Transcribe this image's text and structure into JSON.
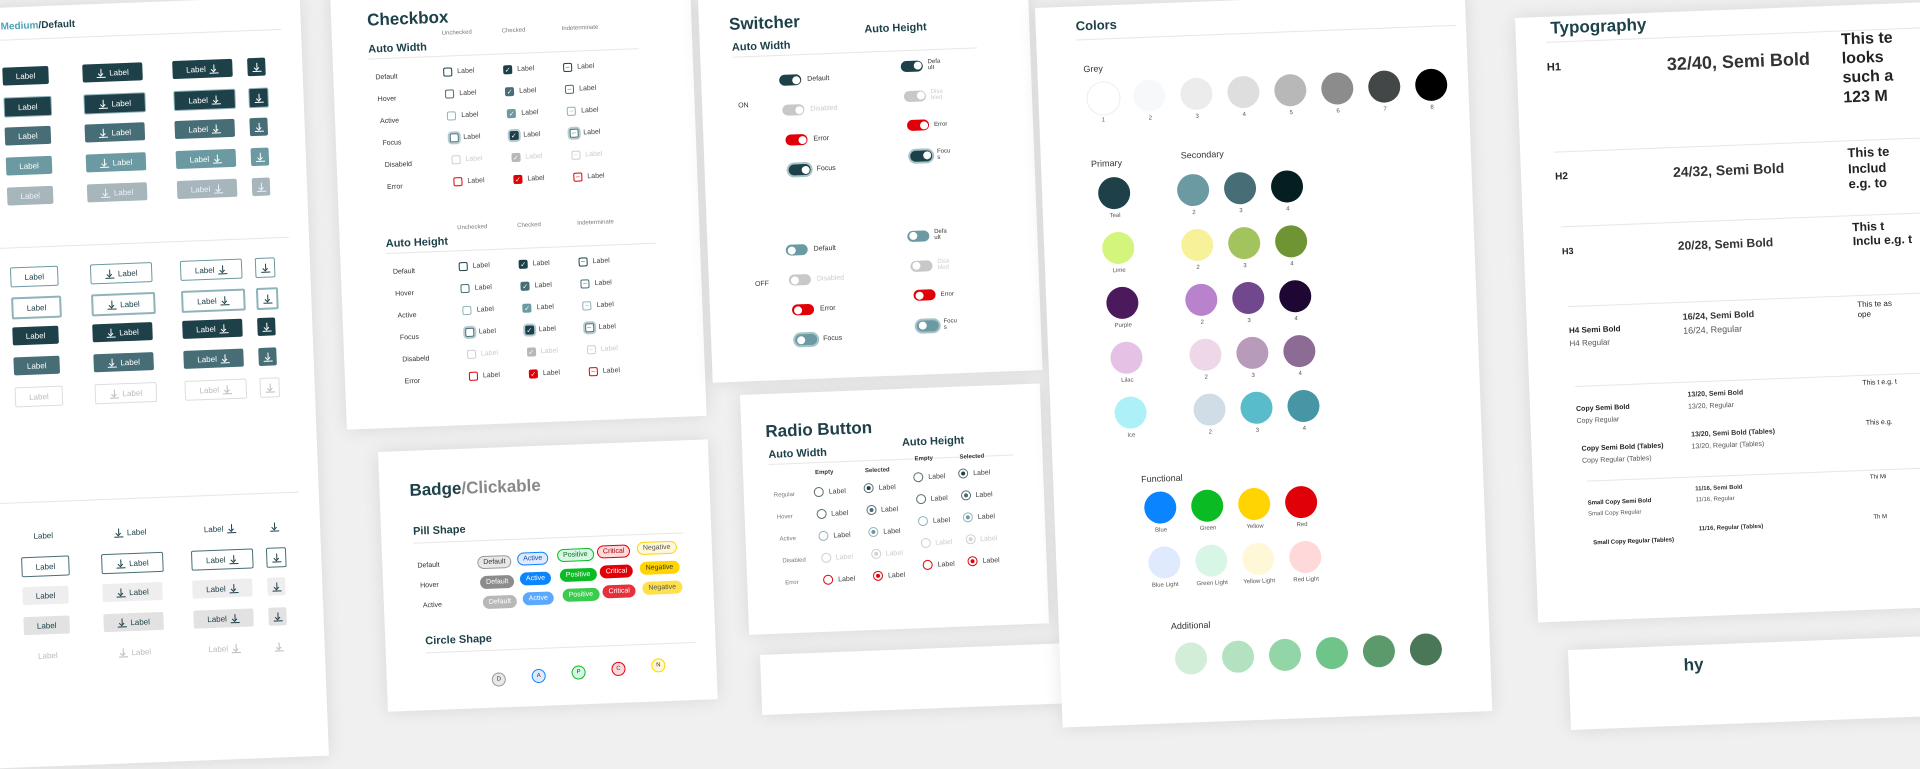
{
  "buttons_card": {
    "title_prefix": "Medium",
    "title_sep": "/",
    "title_suffix": "Default",
    "label": "Label"
  },
  "checkbox_card": {
    "title": "Checkbox",
    "sections": [
      {
        "title": "Auto Width",
        "columns": [
          "Unchecked",
          "Checked",
          "Indeterminate"
        ]
      },
      {
        "title": "Auto Height",
        "columns": [
          "Unchecked",
          "Checked",
          "Indeterminate"
        ]
      }
    ],
    "states": [
      "Default",
      "Hover",
      "Active",
      "Focus",
      "Disabeld",
      "Error"
    ],
    "label": "Label"
  },
  "badge_card": {
    "title": "Badge",
    "title_sep": "/",
    "title_suffix": "Clickable",
    "pill_section": "Pill Shape",
    "circle_section": "Circle Shape",
    "states": [
      "Default",
      "Hover",
      "Active"
    ],
    "kinds": [
      "Default",
      "Active",
      "Positive",
      "Critical",
      "Negative"
    ],
    "circle_letters": [
      "D",
      "A",
      "P",
      "C",
      "N"
    ]
  },
  "switcher_card": {
    "title": "Switcher",
    "col_auto_width": "Auto Width",
    "col_auto_height": "Auto Height",
    "on_label": "ON",
    "off_label": "OFF",
    "states": [
      "Default",
      "Disabled",
      "Error",
      "Focus"
    ],
    "states_wrapped": [
      "Defa ult",
      "Disa bled",
      "Error",
      "Focu s"
    ]
  },
  "radio_card": {
    "title": "Radio Button",
    "col_auto_width": "Auto Width",
    "col_auto_height": "Auto Height",
    "columns": [
      "Empty",
      "Selected"
    ],
    "states": [
      "Regular",
      "Hover",
      "Active",
      "Disabled",
      "Error"
    ],
    "label": "Label"
  },
  "colors_card": {
    "title": "Colors",
    "grey": {
      "title": "Grey",
      "swatches": [
        {
          "label": "1",
          "color": "#ffffff"
        },
        {
          "label": "2",
          "color": "#f7f8f9"
        },
        {
          "label": "3",
          "color": "#ececec"
        },
        {
          "label": "4",
          "color": "#dedede"
        },
        {
          "label": "5",
          "color": "#b8b8b8"
        },
        {
          "label": "6",
          "color": "#8c8c8c"
        },
        {
          "label": "7",
          "color": "#434748"
        },
        {
          "label": "8",
          "color": "#000000"
        }
      ]
    },
    "primary": {
      "title": "Primary",
      "swatches": [
        {
          "label": "Teal",
          "color": "#1d4049"
        },
        {
          "label": "Lime",
          "color": "#d4f57b"
        },
        {
          "label": "Purple",
          "color": "#4b1a5c"
        },
        {
          "label": "Lilac",
          "color": "#e6c1e6"
        },
        {
          "label": "Ice",
          "color": "#aef0f8"
        }
      ]
    },
    "secondary": {
      "title": "Secondary",
      "rows": [
        [
          {
            "label": "2",
            "color": "#6b9aa2"
          },
          {
            "label": "3",
            "color": "#476e76"
          },
          {
            "label": "4",
            "color": "#041e22"
          }
        ],
        [
          {
            "label": "2",
            "color": "#f7f29a"
          },
          {
            "label": "3",
            "color": "#a3c45c"
          },
          {
            "label": "4",
            "color": "#6f9433"
          }
        ],
        [
          {
            "label": "2",
            "color": "#b883cc"
          },
          {
            "label": "3",
            "color": "#71478d"
          },
          {
            "label": "4",
            "color": "#1e0733"
          }
        ],
        [
          {
            "label": "2",
            "color": "#eed8e8"
          },
          {
            "label": "3",
            "color": "#b89bbb"
          },
          {
            "label": "4",
            "color": "#8c6c94"
          }
        ],
        [
          {
            "label": "2",
            "color": "#d0dde6"
          },
          {
            "label": "3",
            "color": "#58bccb"
          },
          {
            "label": "4",
            "color": "#4696a6"
          }
        ]
      ]
    },
    "functional": {
      "title": "Functional",
      "rows": [
        [
          {
            "label": "Blue",
            "color": "#0a84ff"
          },
          {
            "label": "Green",
            "color": "#0bbb23"
          },
          {
            "label": "Yellow",
            "color": "#ffd400"
          },
          {
            "label": "Red",
            "color": "#e00008"
          }
        ],
        [
          {
            "label": "Blue Light",
            "color": "#e0eaff"
          },
          {
            "label": "Green Light",
            "color": "#d8f6e6"
          },
          {
            "label": "Yellow Light",
            "color": "#fff8d8"
          },
          {
            "label": "Red Light",
            "color": "#ffd8da"
          }
        ]
      ]
    },
    "additional": {
      "title": "Additional",
      "swatches": [
        {
          "color": "#d3eed8"
        },
        {
          "color": "#b2e2c0"
        },
        {
          "color": "#92d5a6"
        },
        {
          "color": "#6ec489"
        },
        {
          "color": "#5c9a6c"
        },
        {
          "color": "#4a7758"
        }
      ]
    }
  },
  "typography_card": {
    "title": "Typography",
    "rows": [
      {
        "name": "H1",
        "spec": "32/40, Semi Bold",
        "sample": "This te looks such a 123 M"
      },
      {
        "name": "H2",
        "spec": "24/32, Semi Bold",
        "sample": "This te Includ e.g. to"
      },
      {
        "name": "H3",
        "spec": "20/28, Semi Bold",
        "sample": "This t Inclu e.g. t"
      },
      {
        "name": "H4 Semi Bold",
        "name2": "H4 Regular",
        "spec": "16/24, Semi Bold",
        "spec2": "16/24, Regular",
        "sample": "This te as ope"
      },
      {
        "name": "Copy Semi Bold",
        "name2": "Copy Regular",
        "spec": "13/20, Semi Bold",
        "spec2": "13/20, Regular",
        "sample": "This t e.g. t"
      },
      {
        "name": "Copy Semi Bold (Tables)",
        "name2": "Copy Regular (Tables)",
        "spec": "13/20, Semi Bold (Tables)",
        "spec2": "13/20, Regular (Tables)",
        "sample": "This e.g."
      },
      {
        "name": "Small Copy Semi Bold",
        "name2": "Small Copy Regular",
        "spec": "11/16, Semi Bold",
        "spec2": "11/16, Regular",
        "sample": "Thi Mi"
      },
      {
        "name": "Small Copy Regular (Tables)",
        "spec": "11/16, Regular (Tables)",
        "sample": "Th M"
      }
    ],
    "next_title_fragment": "hy"
  }
}
